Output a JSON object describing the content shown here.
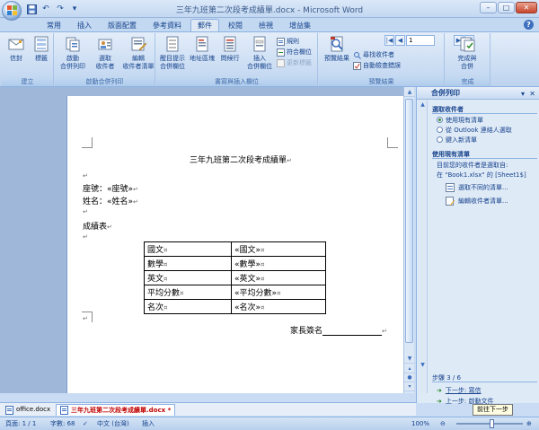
{
  "window": {
    "title": "三年九班第二次段考成績單.docx - Microsoft Word"
  },
  "qat": {
    "save_icon": "save-icon",
    "undo_glyph": "↶",
    "redo_glyph": "↷",
    "more_glyph": "▾"
  },
  "ribbon_tabs": [
    "常用",
    "插入",
    "版面配置",
    "參考資料",
    "郵件",
    "校閱",
    "檢視",
    "增益集"
  ],
  "active_tab": "郵件",
  "ribbon": {
    "groups": {
      "create": "建立",
      "start_merge": "啟動合併列印",
      "write_insert": "書寫與插入欄位",
      "preview": "預覽結果",
      "finish": "完成"
    },
    "buttons": {
      "envelopes": "信封",
      "labels": "標籤",
      "start_merge_l1": "啟動",
      "start_merge_l2": "合併列印",
      "select_recipients_l1": "選取",
      "select_recipients_l2": "收件者",
      "edit_list_l1": "編輯",
      "edit_list_l2": "收件者清單",
      "highlight_l1": "醒目提示",
      "highlight_l2": "合併欄位",
      "address_block": "地址區塊",
      "greeting_line": "問候行",
      "insert_field_l1": "插入",
      "insert_field_l2": "合併欄位",
      "rules": "規則",
      "match_fields": "符合欄位",
      "update_labels": "更新標籤",
      "preview_results": "預覽結果",
      "find_recipient": "尋找收件者",
      "auto_check": "自動檢查錯誤",
      "finish_l1": "完成與",
      "finish_l2": "合併"
    },
    "record_number": "1"
  },
  "document": {
    "title": "三年九班第二次段考成績單",
    "seat_label": "座號：«座號»",
    "name_label": "姓名：«姓名»",
    "grades_label": "成績表",
    "para_mark": "↵",
    "table": [
      [
        "國文",
        "«國文»"
      ],
      [
        "數學",
        "«數學»"
      ],
      [
        "英文",
        "«英文»"
      ],
      [
        "平均分數",
        "«平均分數»"
      ],
      [
        "名次",
        "«名次»"
      ]
    ],
    "signature_label": "家長簽名"
  },
  "taskpane": {
    "title": "合併列印",
    "select_recipients_heading": "選取收件者",
    "options": [
      {
        "label": "使用現有清單",
        "selected": true
      },
      {
        "label": "從 Outlook 連絡人選取",
        "selected": false
      },
      {
        "label": "鍵入新清單",
        "selected": false
      }
    ],
    "existing_list_heading": "使用現有清單",
    "existing_list_text_1": "目前您的收件者是選取自:",
    "existing_list_text_2": "在 \"Book1.xlsx\" 的 [Sheet1$]",
    "link_select_other": "選取不同的清單...",
    "link_edit_list": "編輯收件者清單...",
    "step": "步驟 3 / 6",
    "next_step": "下一步: 寫信",
    "prev_step": "上一步: 啟動文件",
    "tooltip": "前往下一步"
  },
  "doc_tabs": [
    {
      "label": "office.docx",
      "active": false
    },
    {
      "label": "三年九班第二次段考成績單.docx *",
      "active": true
    }
  ],
  "statusbar": {
    "page": "頁面: 1 / 1",
    "words": "字數: 68",
    "language": "中文 (台灣)",
    "mode": "插入",
    "zoom": "100%"
  },
  "colors": {
    "ribbon_bg": "#c9dcf3",
    "accent": "#15428b",
    "active_doc_tab": "#c00000"
  }
}
